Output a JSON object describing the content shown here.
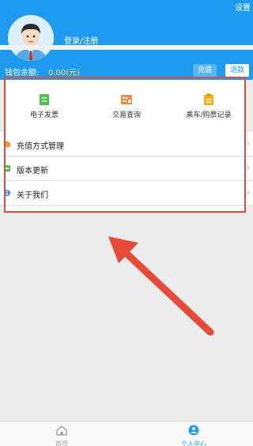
{
  "header": {
    "settings_label": "设置",
    "login_label": "登录/注册",
    "balance_label": "钱包余额:",
    "balance_value": "0.00(元)",
    "recharge_label": "充值",
    "refund_label": "退款"
  },
  "quick_actions": [
    {
      "label": "电子发票",
      "icon": "invoice-icon"
    },
    {
      "label": "交易查询",
      "icon": "transaction-icon"
    },
    {
      "label": "乘车/购票记录",
      "icon": "ride-record-icon"
    }
  ],
  "menu": [
    {
      "label": "充值方式管理",
      "icon": "recharge-method-icon"
    },
    {
      "label": "版本更新",
      "icon": "update-icon"
    },
    {
      "label": "关于我们",
      "icon": "about-icon"
    }
  ],
  "tabbar": {
    "home_label": "首页",
    "me_label": "个人中心"
  },
  "colors": {
    "primary": "#1e9bf0",
    "balance": "#ffe15a",
    "highlight": "#e84a3a"
  }
}
